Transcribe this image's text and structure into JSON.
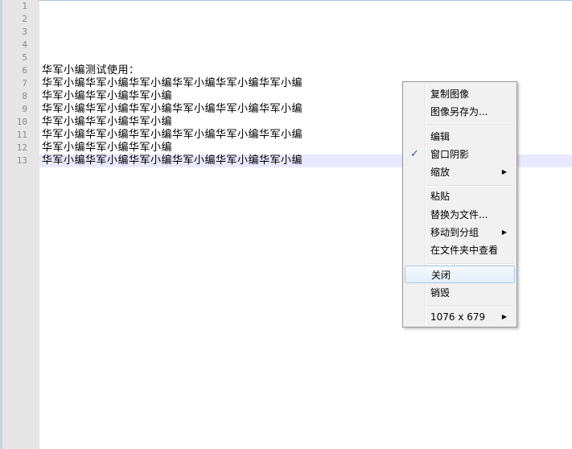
{
  "editor": {
    "line_numbers": [
      "1",
      "2",
      "3",
      "4",
      "5",
      "6",
      "7",
      "8",
      "9",
      "10",
      "11",
      "12",
      "13"
    ],
    "lines": [
      "",
      "",
      "",
      "",
      "",
      "华军小编测试使用：",
      "华军小编华军小编华军小编华军小编华军小编华军小编",
      "华军小编华军小编华军小编",
      "华军小编华军小编华军小编华军小编华军小编华军小编",
      "华军小编华军小编华军小编",
      "华军小编华军小编华军小编华军小编华军小编华军小编",
      "华军小编华军小编华军小编",
      "华军小编华军小编华军小编华军小编华军小编华军小编"
    ]
  },
  "context_menu": {
    "copy_image": "复制图像",
    "save_image_as": "图像另存为...",
    "edit": "编辑",
    "window_shadow": "窗口阴影",
    "window_shadow_checked": "✓",
    "zoom": "缩放",
    "paste": "粘贴",
    "replace_with_file": "替换为文件...",
    "move_to_group": "移动到分组",
    "view_in_folder": "在文件夹中查看",
    "close": "关闭",
    "destroy": "销毁",
    "dimensions": "1076 x 679",
    "submenu_arrow": "▶"
  }
}
